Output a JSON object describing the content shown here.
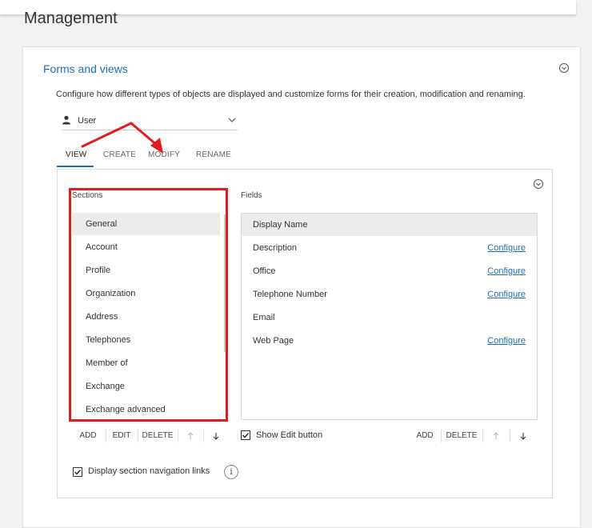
{
  "page": {
    "title": "Management"
  },
  "card": {
    "title": "Forms and views",
    "description": "Configure how different types of objects are displayed and customize forms for their creation, modification and renaming."
  },
  "object_select": {
    "value": "User"
  },
  "tabs": [
    "VIEW",
    "CREATE",
    "MODIFY",
    "RENAME"
  ],
  "active_tab": "VIEW",
  "sections": {
    "label": "Sections",
    "items": [
      "General",
      "Account",
      "Profile",
      "Organization",
      "Address",
      "Telephones",
      "Member of",
      "Exchange",
      "Exchange advanced"
    ],
    "selected": "General",
    "buttons": {
      "add": "ADD",
      "edit": "EDIT",
      "delete": "DELETE"
    }
  },
  "fields": {
    "label": "Fields",
    "items": [
      {
        "name": "Display Name",
        "configure": ""
      },
      {
        "name": "Description",
        "configure": "Configure"
      },
      {
        "name": "Office",
        "configure": "Configure"
      },
      {
        "name": "Telephone Number",
        "configure": "Configure"
      },
      {
        "name": "Email",
        "configure": ""
      },
      {
        "name": "Web Page",
        "configure": "Configure"
      }
    ],
    "selected": "Display Name",
    "show_edit_button": {
      "label": "Show Edit button",
      "checked": true
    },
    "buttons": {
      "add": "ADD",
      "delete": "DELETE"
    }
  },
  "display_section_nav": {
    "label": "Display section navigation links",
    "checked": true
  },
  "colors": {
    "accent": "#1f6fb5",
    "annotation": "#e01e1e"
  }
}
